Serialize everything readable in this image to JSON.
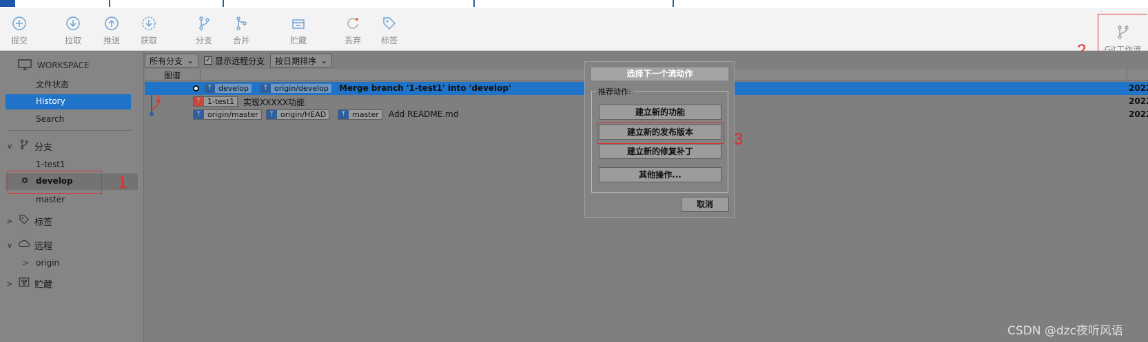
{
  "toolbar": {
    "commit": "提交",
    "pull": "拉取",
    "push": "推送",
    "fetch": "获取",
    "branch": "分支",
    "merge": "合并",
    "stash": "贮藏",
    "discard": "丢弃",
    "tag": "标签",
    "gitflow": "Git工作流"
  },
  "sidebar": {
    "workspace": "WORKSPACE",
    "file_status": "文件状态",
    "history": "History",
    "search": "Search",
    "branches_header": "分支",
    "branches": [
      "1-test1",
      "develop",
      "master"
    ],
    "tags_header": "标签",
    "remotes_header": "远程",
    "remotes": [
      "origin"
    ],
    "stashes_header": "贮藏"
  },
  "filters": {
    "all_branches": "所有分支",
    "show_remote": "显示远程分支",
    "sort_by_date": "按日期排序"
  },
  "columns": {
    "graph": "图谱"
  },
  "commits": [
    {
      "tags": [
        "develop",
        "origin/develop"
      ],
      "message": "Merge branch '1-test1' into 'develop'",
      "date": "2022",
      "selected": true
    },
    {
      "tags": [
        "1-test1"
      ],
      "message": "实现XXXXX功能",
      "date": "2022",
      "selected": false
    },
    {
      "tags": [
        "origin/master",
        "origin/HEAD",
        "master"
      ],
      "message": "Add README.md",
      "date": "2022",
      "selected": false
    }
  ],
  "dialog": {
    "title": "选择下一个流动作",
    "group_label": "推荐动作:",
    "buttons": [
      "建立新的功能",
      "建立新的发布版本",
      "建立新的修复补丁",
      "其他操作..."
    ],
    "cancel": "取消"
  },
  "annotations": [
    "1",
    "2",
    "3"
  ],
  "watermark": "CSDN @dzc夜听风语",
  "colors": {
    "selection": "#1f73c8",
    "annotation": "#e02a2a",
    "toolbar_bg": "#f3f3f3"
  }
}
